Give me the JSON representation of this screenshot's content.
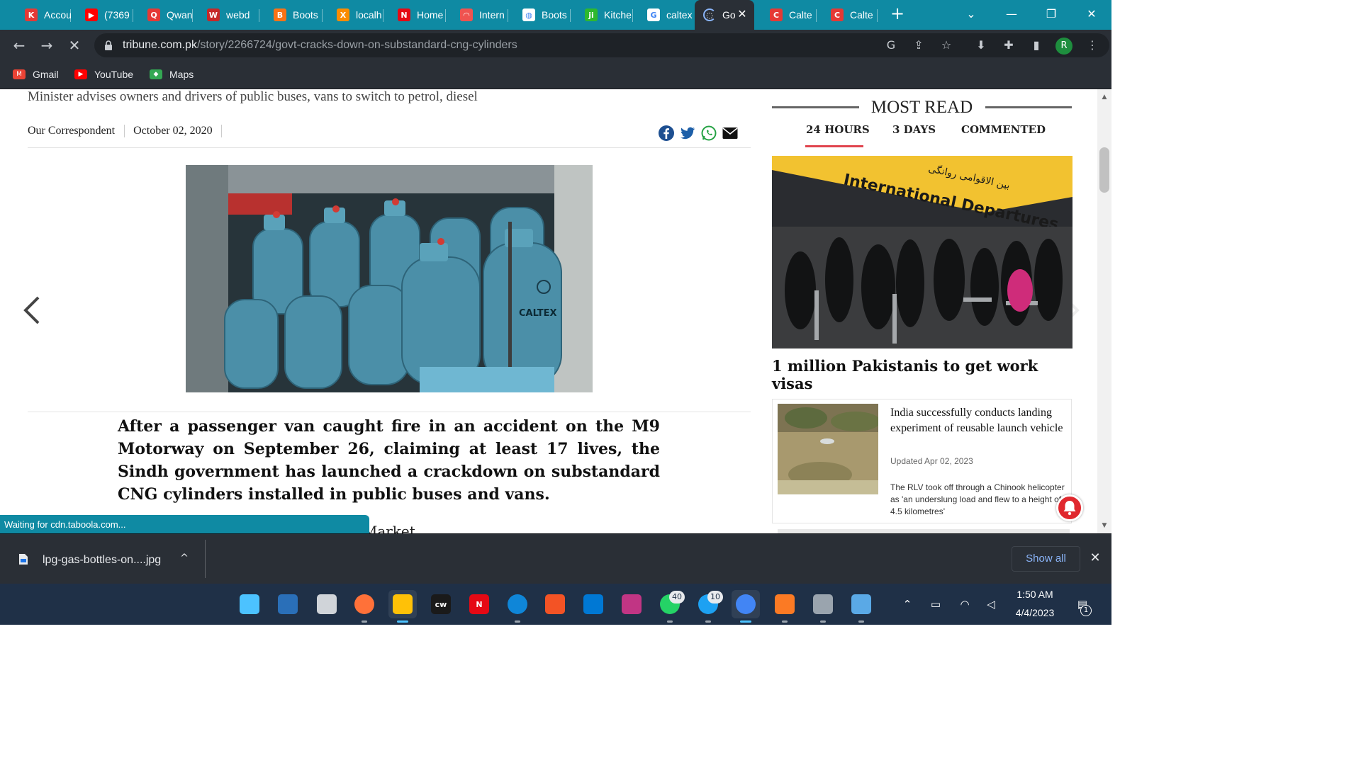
{
  "browser": {
    "tabs": [
      {
        "title": "Accou",
        "icon": "k-icon",
        "color": "#e53935",
        "glyph": "K"
      },
      {
        "title": "(7369",
        "icon": "youtube-icon",
        "color": "#ff0000",
        "glyph": "▶"
      },
      {
        "title": "Qwan",
        "icon": "qwanturank-icon",
        "color": "#e53935",
        "glyph": "Q"
      },
      {
        "title": "webd",
        "icon": "webd-icon",
        "color": "#c62828",
        "glyph": "W"
      },
      {
        "title": "Boots",
        "icon": "bootstrap-icon",
        "color": "#f97316",
        "glyph": "B"
      },
      {
        "title": "localh",
        "icon": "xampp-icon",
        "color": "#fb8c00",
        "glyph": "X"
      },
      {
        "title": "Home",
        "icon": "netflix-icon",
        "color": "#e50914",
        "glyph": "N"
      },
      {
        "title": "Intern",
        "icon": "speedtest-icon",
        "color": "#ef5350",
        "glyph": "◠"
      },
      {
        "title": "Boots",
        "icon": "globe-icon",
        "color": "#ffffff",
        "glyph": "◍"
      },
      {
        "title": "Kitche",
        "icon": "jiji-icon",
        "color": "#2eb82e",
        "glyph": "ji"
      },
      {
        "title": "caltex",
        "icon": "google-icon",
        "color": "#ffffff",
        "glyph": "G"
      },
      {
        "title": "Go",
        "icon": "loading-spinner-icon",
        "color": "#2a2f36",
        "glyph": "◌"
      },
      {
        "title": "Calte",
        "icon": "caltex-icon",
        "color": "#e53935",
        "glyph": "C"
      },
      {
        "title": "Calte",
        "icon": "caltex-icon",
        "color": "#e53935",
        "glyph": "C"
      }
    ],
    "new_tab": "+",
    "url_host": "tribune.com.pk",
    "url_path": "/story/2266724/govt-cracks-down-on-substandard-cng-cylinders",
    "profile_initial": "R",
    "bookmarks": [
      {
        "label": "Gmail",
        "icon": "gmail-icon",
        "color": "#ea4335"
      },
      {
        "label": "YouTube",
        "icon": "youtube-icon",
        "color": "#ff0000"
      },
      {
        "label": "Maps",
        "icon": "maps-icon",
        "color": "#34a853"
      }
    ]
  },
  "article": {
    "subtitle": "Minister advises owners and drivers of public buses, vans to switch to petrol, diesel",
    "author": "Our Correspondent",
    "date": "October 02, 2020",
    "photo_text_caltex": "CALTEX",
    "lead": "After a passenger van caught fire in an accident on the M9 Motorway on September 26, claiming at least 17 lives, the Sindh government has launched a crackdown on substandard CNG cylinders installed in public buses and vans.",
    "next_line": "...in the surroundings of Empress Market"
  },
  "sidebar": {
    "heading": "MOST READ",
    "tabs": [
      "24 HOURS",
      "3 DAYS",
      "COMMENTED"
    ],
    "active_tab_color": "#e0444d",
    "feature_sign": "International Departures",
    "feature_sign_urdu": "بین الاقوامی روانگی",
    "feature_title": "1 million Pakistanis to get work visas",
    "card": {
      "title": "India successfully conducts landing experiment of reusable launch vehicle",
      "updated": "Updated Apr 02, 2023",
      "description": "The RLV took off through a Chinook helicopter as 'an underslung load and flew to a height of 4.5 kilometres'"
    }
  },
  "status_text": "Waiting for cdn.taboola.com...",
  "downloads": {
    "file_name": "lpg-gas-bottles-on....jpg",
    "show_all": "Show all"
  },
  "taskbar": {
    "apps": [
      {
        "name": "start-icon"
      },
      {
        "name": "search-icon"
      },
      {
        "name": "task-view-icon"
      },
      {
        "name": "firefox-icon"
      },
      {
        "name": "file-explorer-icon"
      },
      {
        "name": "cw-icon",
        "label": "cw"
      },
      {
        "name": "netflix-icon",
        "label": "N"
      },
      {
        "name": "edge-icon"
      },
      {
        "name": "microsoft-store-icon"
      },
      {
        "name": "vscode-icon"
      },
      {
        "name": "instagram-icon"
      },
      {
        "name": "whatsapp-icon",
        "badge": "40"
      },
      {
        "name": "twitter-icon",
        "badge": "10"
      },
      {
        "name": "chrome-icon"
      },
      {
        "name": "xampp-icon"
      },
      {
        "name": "settings-icon"
      },
      {
        "name": "photos-icon"
      }
    ],
    "time": "1:50 AM",
    "date": "4/4/2023",
    "notification_count": "1"
  }
}
